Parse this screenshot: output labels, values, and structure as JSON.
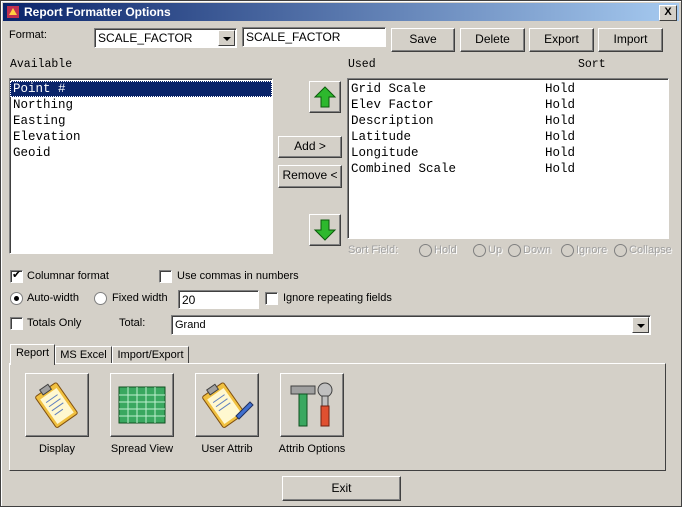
{
  "window": {
    "title": "Report Formatter Options",
    "close_label": "X"
  },
  "format": {
    "label": "Format:",
    "combo_value": "SCALE_FACTOR",
    "name_value": "SCALE_FACTOR",
    "buttons": {
      "save": "Save",
      "delete": "Delete",
      "export": "Export",
      "import": "Import"
    }
  },
  "available": {
    "label": "Available",
    "items": [
      "Point #",
      "Northing",
      "Easting",
      "Elevation",
      "Geoid"
    ],
    "selected_index": 0
  },
  "middle": {
    "add": "Add >",
    "remove": "Remove <"
  },
  "used": {
    "label": "Used",
    "sort_label": "Sort",
    "rows": [
      {
        "name": "Grid Scale",
        "sort": "Hold"
      },
      {
        "name": "Elev Factor",
        "sort": "Hold"
      },
      {
        "name": "Description",
        "sort": "Hold"
      },
      {
        "name": "Latitude",
        "sort": "Hold"
      },
      {
        "name": "Longitude",
        "sort": "Hold"
      },
      {
        "name": "Combined Scale",
        "sort": "Hold"
      }
    ]
  },
  "sort_field": {
    "label": "Sort Field:",
    "options": [
      "Hold",
      "Up",
      "Down",
      "Ignore",
      "Collapse"
    ]
  },
  "options": {
    "columnar": {
      "label": "Columnar format",
      "checked": true
    },
    "commas": {
      "label": "Use commas in numbers",
      "checked": false
    },
    "auto_width": {
      "label": "Auto-width",
      "selected": true
    },
    "fixed_width": {
      "label": "Fixed width",
      "selected": false
    },
    "width_value": "20",
    "ignore_repeating": {
      "label": "Ignore repeating fields",
      "checked": false
    },
    "totals_only": {
      "label": "Totals Only",
      "checked": false
    },
    "total_label": "Total:",
    "total_value": "Grand"
  },
  "tabs": [
    "Report",
    "MS Excel",
    "Import/Export"
  ],
  "tools": [
    "Display",
    "Spread View",
    "User Attrib",
    "Attrib Options"
  ],
  "exit_label": "Exit"
}
